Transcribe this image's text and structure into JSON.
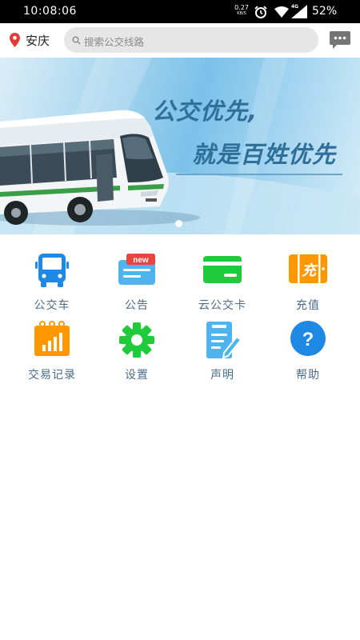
{
  "status_bar": {
    "time": "10:08:06",
    "net_speed": "0.27",
    "net_speed_unit": "KB/S",
    "network_type": "4G",
    "battery": "52%"
  },
  "header": {
    "location": "安庆",
    "search_placeholder": "搜索公交线路",
    "message_icon": "chat-bubble-icon"
  },
  "banner": {
    "line1": "公交优先,",
    "line2": "就是百姓优先",
    "active_slide": 1,
    "slide_count": 1
  },
  "grid": {
    "items": [
      {
        "label": "公交车",
        "icon": "bus-icon",
        "color": "#1e88e5"
      },
      {
        "label": "公告",
        "icon": "announcement-new-icon",
        "color": "#4fb4ee",
        "badge": "new"
      },
      {
        "label": "云公交卡",
        "icon": "card-icon",
        "color": "#1fcb3a"
      },
      {
        "label": "充值",
        "icon": "recharge-icon",
        "color": "#ff9800",
        "glyph": "充"
      },
      {
        "label": "交易记录",
        "icon": "transaction-chart-icon",
        "color": "#ff9800"
      },
      {
        "label": "设置",
        "icon": "gear-icon",
        "color": "#1fcb3a"
      },
      {
        "label": "声明",
        "icon": "document-edit-icon",
        "color": "#4fb4ee"
      },
      {
        "label": "帮助",
        "icon": "help-icon",
        "color": "#1e88e5",
        "glyph": "?"
      }
    ]
  }
}
